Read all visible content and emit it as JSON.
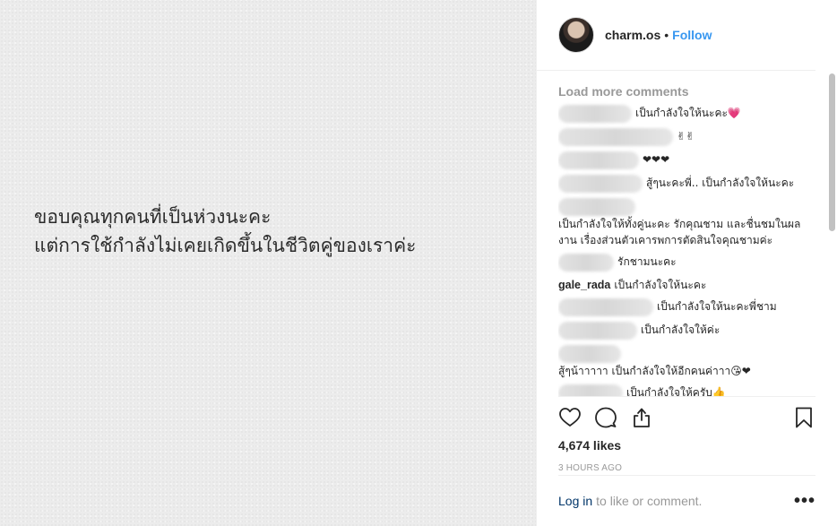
{
  "image_caption": {
    "line1": "ขอบคุณทุกคนที่เป็นห่วงนะคะ",
    "line2": "แต่การใช้กำลังไม่เคยเกิดขึ้นในชีวิตคู่ของเราค่ะ"
  },
  "header": {
    "username": "charm.os",
    "separator": "•",
    "follow_label": "Follow"
  },
  "comments": {
    "load_more": "Load more comments",
    "items": [
      {
        "user": "",
        "text": "เป็นกำลังใจให้นะคะ💗"
      },
      {
        "user": "",
        "text": "✌✌"
      },
      {
        "user": "",
        "text": "❤❤❤"
      },
      {
        "user": "",
        "text": "สู้ๆนะคะพี่.. เป็นกำลังใจให้นะคะ"
      },
      {
        "user": "",
        "text": "เป็นกำลังใจให้ทั้งคู่นะคะ รักคุณชาม และชื่นชมในผลงาน เรื่องส่วนตัวเคารพการตัดสินใจคุณชามค่ะ"
      },
      {
        "user": "",
        "text": "รักชามนะคะ"
      },
      {
        "user": "gale_rada",
        "text": "เป็นกำลังใจให้นะคะ"
      },
      {
        "user": "",
        "text": "เป็นกำลังใจให้นะคะพี่ชาม"
      },
      {
        "user": "",
        "text": "เป็นกำลังใจให้ค่ะ"
      },
      {
        "user": "",
        "text": "สู้ๆน้าาาาา เป็นกำลังใจให้อีกคนค่าาา😘❤"
      },
      {
        "user": "",
        "text": "เป็นกำลังใจให้ครับ👍"
      }
    ]
  },
  "icons": {
    "like": "heart-icon",
    "comment": "comment-icon",
    "share": "share-icon",
    "save": "bookmark-icon"
  },
  "likes": "4,674 likes",
  "time": "3 HOURS AGO",
  "login": {
    "link": "Log in",
    "rest": "to like or comment.",
    "more": "•••"
  },
  "colors": {
    "follow": "#3897f0",
    "muted": "#999999",
    "link": "#003569"
  }
}
